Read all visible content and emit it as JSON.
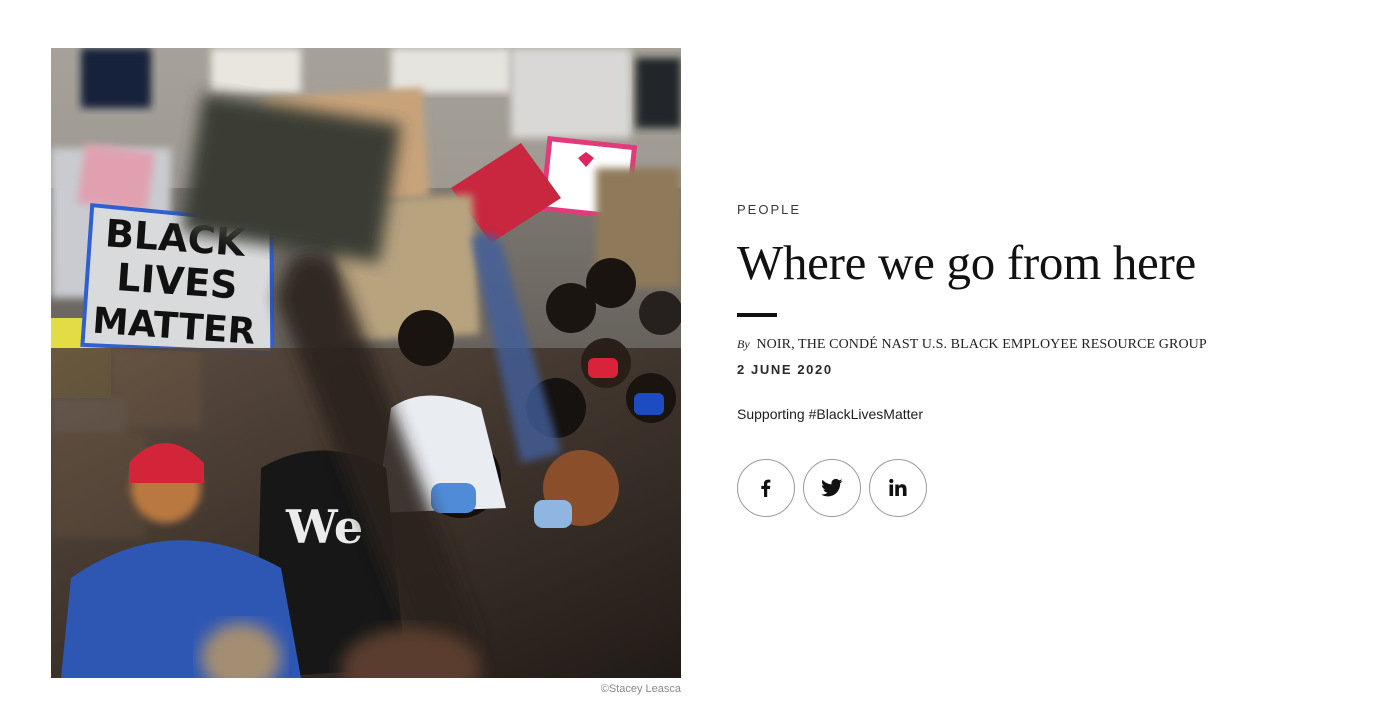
{
  "hero": {
    "image_subject": "protest-crowd-photo",
    "sign_texts": [
      "BLACK",
      "LIVES",
      "MATTER"
    ],
    "credit": "©Stacey Leasca"
  },
  "article": {
    "category": "PEOPLE",
    "headline": "Where we go from here",
    "byline_prefix": "By",
    "byline_author": "NOIR, THE CONDÉ NAST U.S. BLACK EMPLOYEE RESOURCE GROUP",
    "date": "2 JUNE 2020",
    "dek": "Supporting #BlackLivesMatter"
  },
  "share": {
    "buttons": [
      {
        "icon": "facebook-icon"
      },
      {
        "icon": "twitter-icon"
      },
      {
        "icon": "linkedin-icon"
      }
    ]
  },
  "colors": {
    "text": "#111111",
    "muted": "#8a8a8a",
    "border": "#9a9a9a",
    "background": "#ffffff"
  }
}
